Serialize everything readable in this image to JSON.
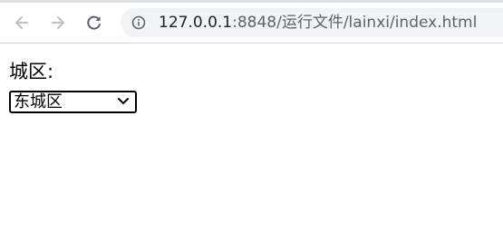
{
  "browser": {
    "url_host": "127.0.0.1",
    "url_path": ":8848/运行文件/lainxi/index.html",
    "icons": {
      "back": "arrow-left-icon",
      "forward": "arrow-right-icon",
      "reload": "reload-icon",
      "site_info": "info-icon"
    },
    "colors": {
      "omnibox_bg": "#f1f3f4",
      "nav_icon": "#5f6368",
      "nav_icon_disabled": "#c0c0c0"
    }
  },
  "page": {
    "label": "城区:",
    "select": {
      "selected": "东城区"
    }
  }
}
